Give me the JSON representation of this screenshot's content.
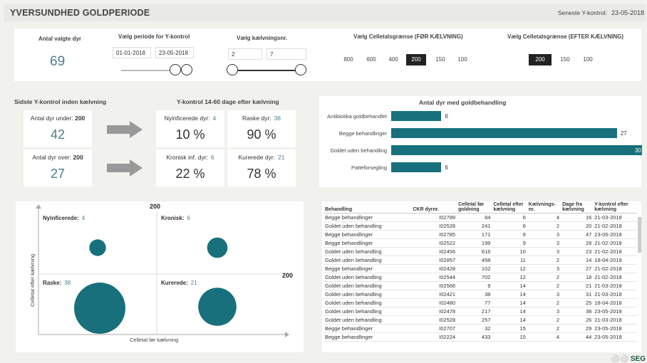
{
  "header": {
    "title": "YVERSUNDHED GOLDPERIODE",
    "latest_label": "Seneste Y-kontrol:",
    "latest_value": "23-05-2018"
  },
  "filters": {
    "count_label": "Antal valgte dyr",
    "count_value": "69",
    "period_label": "Vælg periode for Y-kontrol",
    "period_from": "01-01-2018",
    "period_to": "23-05-2018",
    "calving_label": "Vælg kælvningsnr.",
    "calving_from": "2",
    "calving_to": "7",
    "before_label": "Vælg Celletalsgrænse (FØR KÆLVNING)",
    "before_options": [
      "800",
      "600",
      "400",
      "200",
      "150",
      "100"
    ],
    "before_selected": "200",
    "after_label": "Vælg Celletalsgrænse (EFTER KÆLVNING)",
    "after_options": [
      "200",
      "150",
      "100"
    ],
    "after_selected": "200"
  },
  "before_calving": {
    "title": "Sidste Y-kontrol inden kælvning",
    "under_label": "Antal dyr under:",
    "under_threshold": "200",
    "under_value": "42",
    "over_label": "Antal dyr over:",
    "over_threshold": "200",
    "over_value": "27"
  },
  "after_calving": {
    "title": "Y-kontrol 14-60 dage efter kælvning",
    "new_label": "Nyinficerede dyr:",
    "new_count": "4",
    "new_pct": "10 %",
    "healthy_label": "Raske dyr:",
    "healthy_count": "38",
    "healthy_pct": "90 %",
    "chronic_label": "Kronisk inf. dyr:",
    "chronic_count": "6",
    "chronic_pct": "22 %",
    "cured_label": "Kurerede dyr:",
    "cured_count": "21",
    "cured_pct": "78 %"
  },
  "chart_data": [
    {
      "type": "bar",
      "title": "Antal dyr med goldbehandling",
      "categories": [
        "Antibiotika goldbehandlet",
        "Begge behandlinger",
        "Goldet uden behandling",
        "Patteforsegling"
      ],
      "values": [
        6,
        27,
        30,
        6
      ],
      "color": "#18707c"
    },
    {
      "type": "scatter",
      "title": "",
      "xlabel": "Celletal før kælvning",
      "ylabel": "Celletal efter kælvning",
      "threshold_x": "200",
      "threshold_y": "200",
      "quadrants": [
        {
          "label": "Nyinficerede:",
          "value": 4
        },
        {
          "label": "Kronisk:",
          "value": 6
        },
        {
          "label": "Raske:",
          "value": 38
        },
        {
          "label": "Kurerede:",
          "value": 21
        }
      ],
      "color": "#18707c"
    }
  ],
  "table": {
    "columns": [
      "Behandling",
      "CKR dyrnr.",
      "Celletal før goldning",
      "Celletal efter kælvning",
      "Kælvnings-nr.",
      "Dage fra kælvning",
      "Y-kontrol efter kælvning"
    ],
    "rows": [
      [
        "Begge behandlinger",
        "I02789",
        "84",
        "6",
        "4",
        "16",
        "21-03-2018"
      ],
      [
        "Goldet uden behandling",
        "I02528",
        "241",
        "6",
        "2",
        "20",
        "21-02-2018"
      ],
      [
        "Begge behandlinger",
        "I02785",
        "171",
        "9",
        "3",
        "47",
        "23-05-2018"
      ],
      [
        "Begge behandlinger",
        "I02522",
        "199",
        "9",
        "3",
        "28",
        "21-02-2018"
      ],
      [
        "Goldet uden behandling",
        "I02456",
        "616",
        "10",
        "3",
        "23",
        "21-02-2018"
      ],
      [
        "Goldet uden behandling",
        "I02857",
        "458",
        "11",
        "2",
        "14",
        "18-04-2018"
      ],
      [
        "Begge behandlinger",
        "I02428",
        "102",
        "12",
        "3",
        "27",
        "21-02-2018"
      ],
      [
        "Goldet uden behandling",
        "I02544",
        "702",
        "12",
        "2",
        "18",
        "21-02-2018"
      ],
      [
        "Goldet uden behandling",
        "I02566",
        "9",
        "14",
        "2",
        "21",
        "21-03-2018"
      ],
      [
        "Goldet uden behandling",
        "I02421",
        "38",
        "14",
        "3",
        "31",
        "21-03-2018"
      ],
      [
        "Goldet uden behandling",
        "I02480",
        "77",
        "14",
        "2",
        "25",
        "18-04-2018"
      ],
      [
        "Goldet uden behandling",
        "I02478",
        "217",
        "14",
        "3",
        "38",
        "23-05-2018"
      ],
      [
        "Goldet uden behandling",
        "I02528",
        "257",
        "14",
        "2",
        "26",
        "21-03-2018"
      ],
      [
        "Begge behandlinger",
        "I02707",
        "32",
        "15",
        "2",
        "29",
        "23-05-2018"
      ],
      [
        "Begge behandlinger",
        "I02224",
        "433",
        "15",
        "4",
        "44",
        "23-05-2018"
      ]
    ]
  },
  "footer": {
    "logo": "SEG"
  }
}
